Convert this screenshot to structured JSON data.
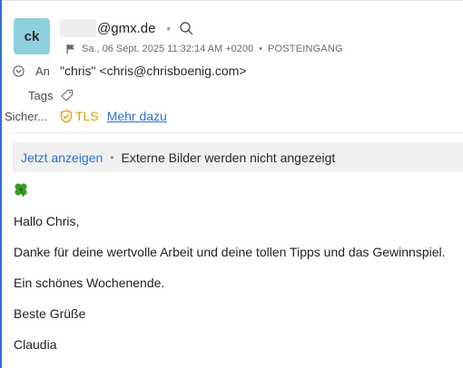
{
  "sender": {
    "initials": "ck",
    "email_visible": "@gmx.de"
  },
  "meta": {
    "date": "Sa., 06 Sept. 2025 11:32:14 AM +0200",
    "folder": "POSTEINGANG"
  },
  "headers": {
    "to_label": "An",
    "to_value": "\"chris\" <chris@chrisboenig.com>",
    "tags_label": "Tags",
    "security_label": "Sicher...",
    "tls_label": "TLS",
    "more_link": "Mehr dazu"
  },
  "images_bar": {
    "show_now": "Jetzt anzeigen",
    "notice": "Externe Bilder werden nicht angezeigt"
  },
  "body": {
    "lines": [
      "Hallo Chris,",
      "Danke für deine wertvolle Arbeit und deine tollen Tipps und das Gewinnspiel.",
      "Ein schönes Wochenende.",
      "Beste Grüße",
      "Claudia"
    ]
  },
  "colors": {
    "accent": "#2f6fd6",
    "avatar_bg": "#8fd0df",
    "tls": "#e0a000",
    "clover": "#3a9a2a"
  },
  "icons": [
    "search-icon",
    "flag-icon",
    "chevron-down-icon",
    "tag-icon",
    "shield-icon",
    "four-leaf-clover-icon"
  ]
}
